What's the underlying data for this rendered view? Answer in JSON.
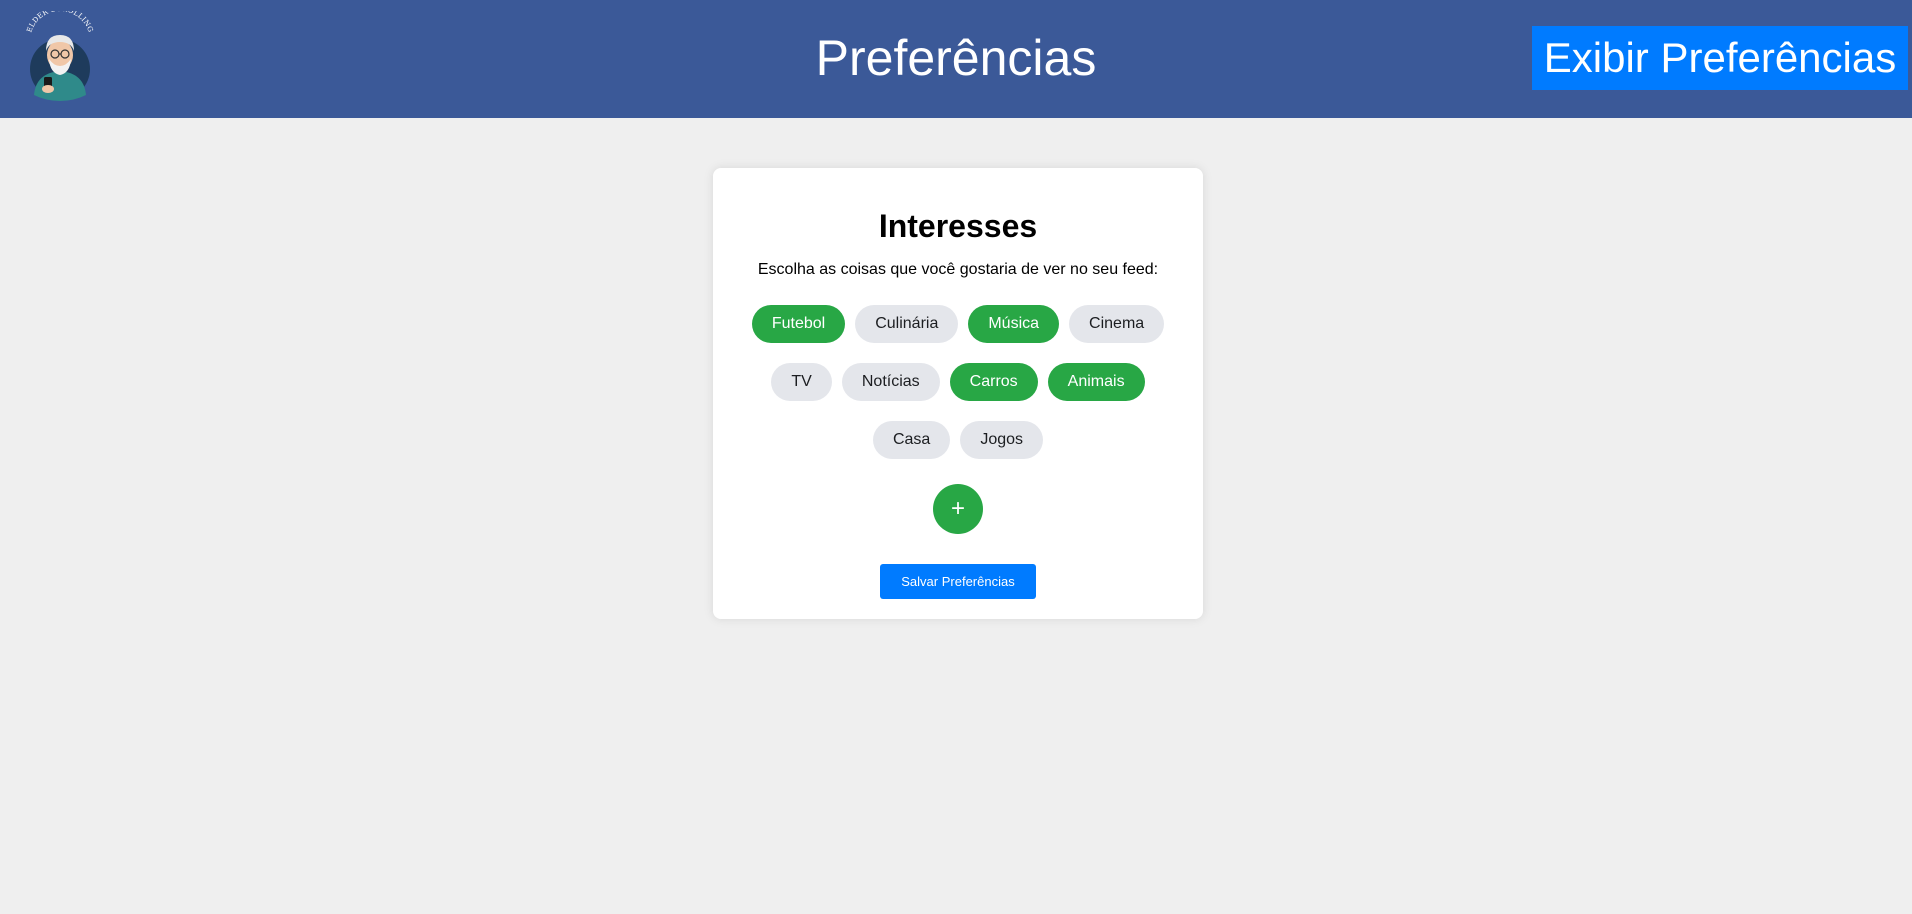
{
  "header": {
    "logo_icon": "elderly-man-with-phone-logo-icon",
    "logo_text": "ELDER SCROLLING",
    "title": "Preferências",
    "show_prefs_label": "Exibir Preferências",
    "background_color": "#3b5998",
    "button_color": "#007bff"
  },
  "card": {
    "title": "Interesses",
    "subtitle": "Escolha as coisas que você gostaria de ver no seu feed:",
    "tags": [
      {
        "label": "Futebol",
        "selected": true
      },
      {
        "label": "Culinária",
        "selected": false
      },
      {
        "label": "Música",
        "selected": true
      },
      {
        "label": "Cinema",
        "selected": false
      },
      {
        "label": "TV",
        "selected": false
      },
      {
        "label": "Notícias",
        "selected": false
      },
      {
        "label": "Carros",
        "selected": true
      },
      {
        "label": "Animais",
        "selected": true
      },
      {
        "label": "Casa",
        "selected": false
      },
      {
        "label": "Jogos",
        "selected": false
      }
    ],
    "add_label": "+",
    "save_label": "Salvar Preferências",
    "selected_color": "#28a745",
    "unselected_color": "#e4e6eb"
  }
}
